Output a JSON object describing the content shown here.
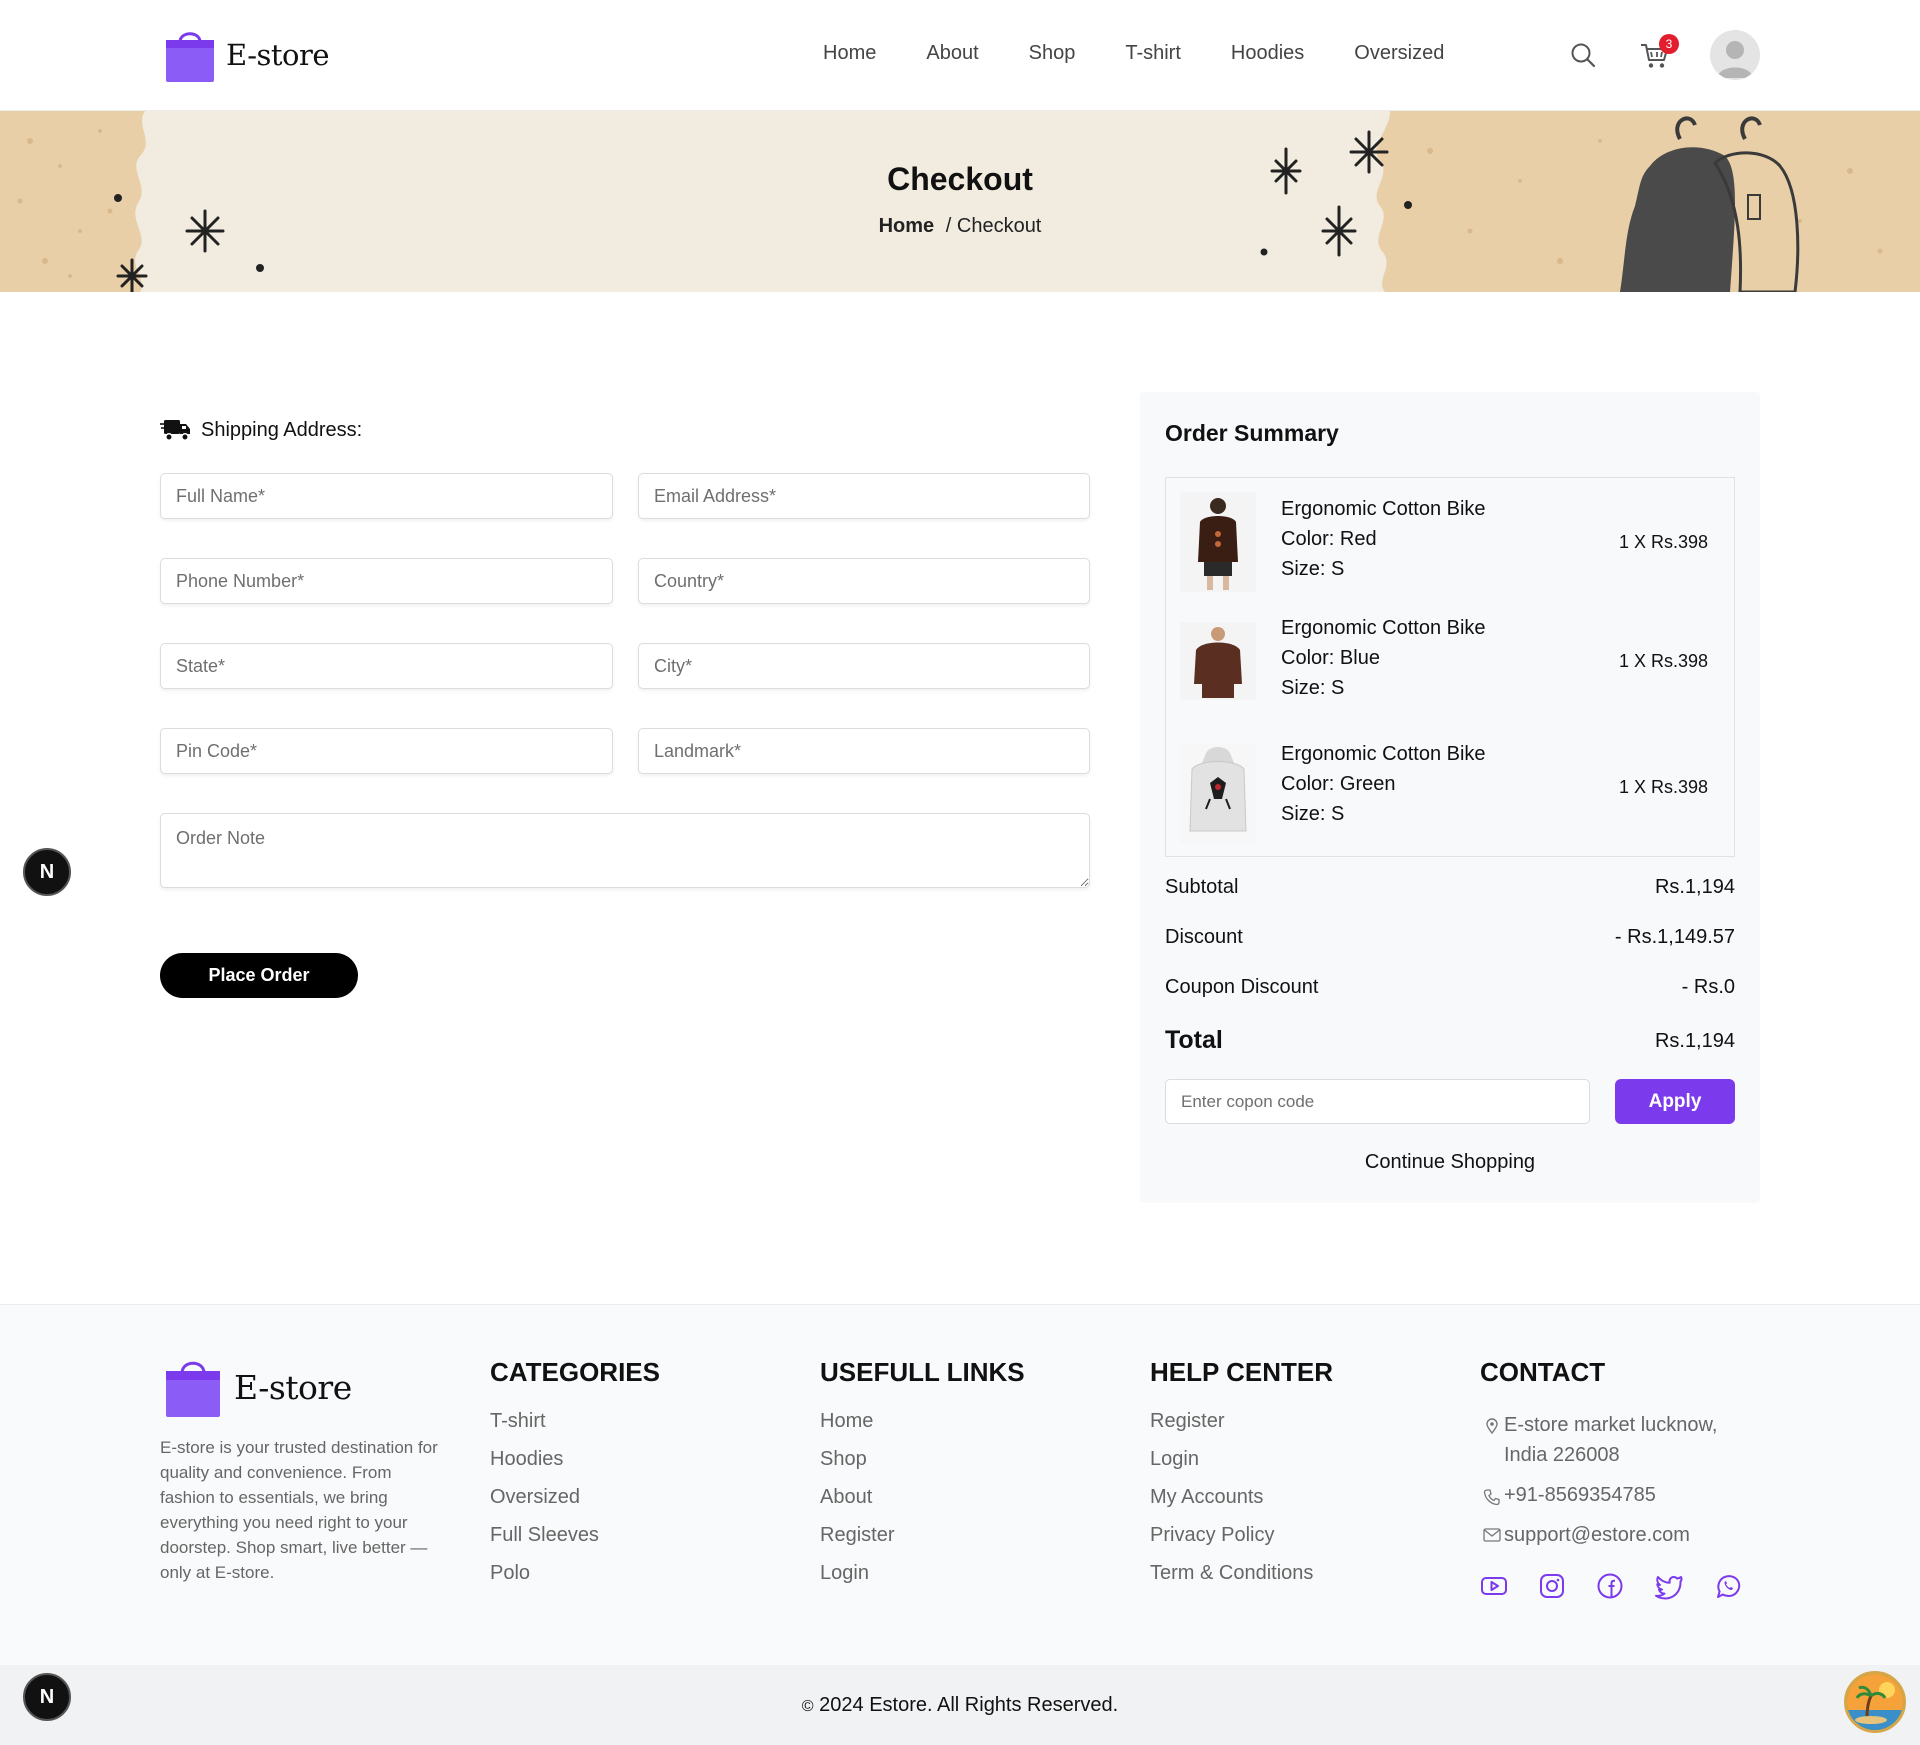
{
  "header": {
    "logo_text": "E-store",
    "nav": [
      "Home",
      "About",
      "Shop",
      "T-shirt",
      "Hoodies",
      "Oversized"
    ],
    "cart_count": "3",
    "icons": [
      "search-icon",
      "cart-icon",
      "user-avatar"
    ]
  },
  "banner": {
    "title": "Checkout",
    "breadcrumb_home": "Home",
    "breadcrumb_sep": "/",
    "breadcrumb_current": "Checkout"
  },
  "shipping": {
    "heading": "Shipping Address:",
    "fields": {
      "full_name": "Full Name*",
      "email": "Email Address*",
      "phone": "Phone Number*",
      "country": "Country*",
      "state": "State*",
      "city": "City*",
      "pin": "Pin Code*",
      "landmark": "Landmark*",
      "note": "Order Note"
    },
    "place_order": "Place Order"
  },
  "summary": {
    "title": "Order Summary",
    "items": [
      {
        "name": "Ergonomic Cotton Bike",
        "color": "Color: Red",
        "size": "Size: S",
        "qty": "1 X Rs.398"
      },
      {
        "name": "Ergonomic Cotton Bike",
        "color": "Color: Blue",
        "size": "Size: S",
        "qty": "1 X Rs.398"
      },
      {
        "name": "Ergonomic Cotton Bike",
        "color": "Color: Green",
        "size": "Size: S",
        "qty": "1 X Rs.398"
      }
    ],
    "subtotal_label": "Subtotal",
    "subtotal": "Rs.1,194",
    "discount_label": "Discount",
    "discount": "- Rs.1,149.57",
    "coupon_discount_label": "Coupon Discount",
    "coupon_discount": "- Rs.0",
    "total_label": "Total",
    "total": "Rs.1,194",
    "coupon_placeholder": "Enter copon code",
    "apply": "Apply",
    "continue": "Continue Shopping"
  },
  "footer": {
    "logo_text": "E-store",
    "description": "E-store is your trusted destination for quality and convenience. From fashion to essentials, we bring everything you need right to your doorstep. Shop smart, live better — only at E-store.",
    "categories": {
      "heading": "CATEGORIES",
      "links": [
        "T-shirt",
        "Hoodies",
        "Oversized",
        "Full Sleeves",
        "Polo"
      ]
    },
    "useful": {
      "heading": "USEFULL LINKS",
      "links": [
        "Home",
        "Shop",
        "About",
        "Register",
        "Login"
      ]
    },
    "help": {
      "heading": "HELP CENTER",
      "links": [
        "Register",
        "Login",
        "My Accounts",
        "Privacy Policy",
        "Term & Conditions"
      ]
    },
    "contact": {
      "heading": "CONTACT",
      "address_line1": "E-store market lucknow,",
      "address_line2": "India 226008",
      "phone": "+91-8569354785",
      "email": "support@estore.com"
    },
    "socials": [
      "youtube-icon",
      "instagram-icon",
      "facebook-icon",
      "twitter-icon",
      "whatsapp-icon"
    ],
    "copyright_symbol": "©",
    "copyright": "2024 Estore. All Rights Reserved."
  },
  "dev_badge_letter": "N",
  "colors": {
    "accent": "#7c3aed",
    "badge": "#e11d2e",
    "banner_bg": "#f1ecdf",
    "banner_kraft": "#e8ceA5"
  }
}
